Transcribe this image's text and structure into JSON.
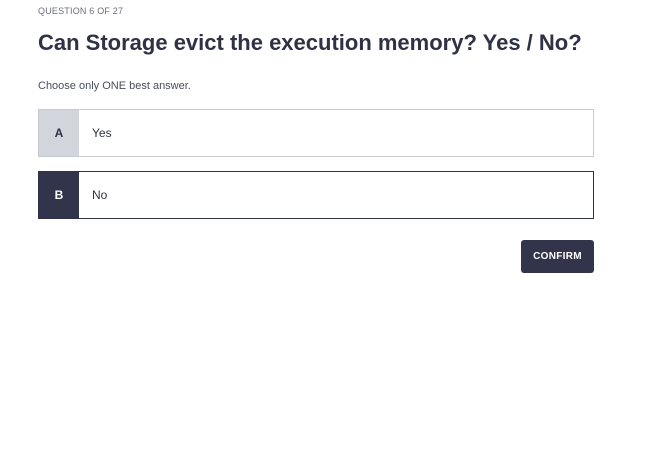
{
  "quiz": {
    "progress": "QUESTION 6 OF 27",
    "question": "Can Storage evict the execution memory? Yes / No?",
    "instruction": "Choose only ONE best answer.",
    "options": [
      {
        "letter": "A",
        "text": "Yes",
        "selected": false
      },
      {
        "letter": "B",
        "text": "No",
        "selected": true
      }
    ],
    "confirm_label": "CONFIRM"
  },
  "colors": {
    "primary": "#31344a",
    "unselected_letter_bg": "#d3d5dd",
    "border_light": "#c9cbd3"
  }
}
